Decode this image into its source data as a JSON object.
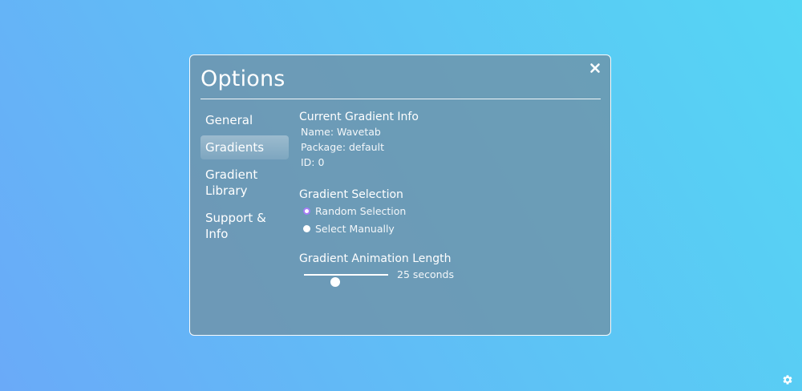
{
  "dialog": {
    "title": "Options"
  },
  "sidebar": {
    "items": [
      {
        "label": "General",
        "active": false
      },
      {
        "label": "Gradients",
        "active": true
      },
      {
        "label": "Gradient Library",
        "active": false
      },
      {
        "label": "Support & Info",
        "active": false
      }
    ]
  },
  "gradient_info": {
    "heading": "Current Gradient Info",
    "name": "Name: Wavetab",
    "package": "Package: default",
    "id": "ID: 0"
  },
  "gradient_selection": {
    "heading": "Gradient Selection",
    "options": [
      {
        "label": "Random Selection",
        "checked": true
      },
      {
        "label": "Select Manually",
        "checked": false
      }
    ]
  },
  "animation": {
    "heading": "Gradient Animation Length",
    "slider_fraction": 0.37,
    "value_label": "25 seconds"
  },
  "colors": {
    "radio_accent": "#a77df7",
    "background_start": "#6aaaf8",
    "background_end": "#55d6f4"
  },
  "icons": {
    "close": "close-icon",
    "settings": "gear-icon"
  }
}
